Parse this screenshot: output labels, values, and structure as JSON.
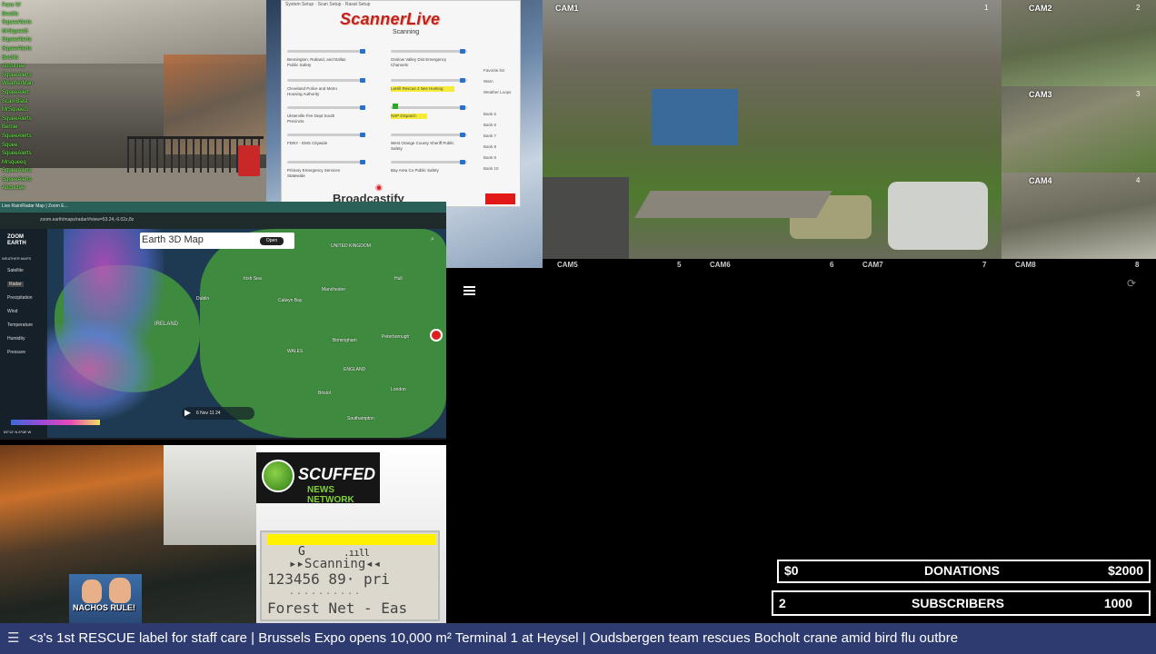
{
  "chat": {
    "lines": [
      "Fans W",
      "BecMc",
      "SqueeAlerts",
      "MrSqueeG",
      "SqueeAlerts",
      "SqueeAlerts",
      "BecMc",
      "Abductee",
      "SqueeAlerts",
      "WeatherMan",
      "SqueeAlert",
      "ScamBlast",
      "MrSqueeG",
      "SqueeAlerts",
      "Bernie",
      "SqueeAlerts",
      "Squee",
      "SqueeAlerts",
      "Mrsqueeq",
      "SqueeAlerts",
      "SqueeAlerts",
      "Abductee"
    ]
  },
  "scanner": {
    "menu": "System Setup · Scan Setup · Rasat Setup",
    "logo": "ScannerLive",
    "status": "Scanning",
    "feeds_left": [
      "Bennington, Rutland, and Dallas Public Safety",
      "Cleveland Police and Metro Housing Authority",
      "Ulsterville Fire Dept South Precincts",
      "FDNY - EMS Citywide",
      "Primary Emergency Services Statewide"
    ],
    "feeds_right": [
      "Onslow Valley Dist Emergency Channels",
      "LaHill Rescue 2 Nes Hunting",
      "NSP Dispatch",
      "West Orange County Sheriff Public Safety",
      "Bay Area Co Public Safety"
    ],
    "radios": [
      "Favorite list",
      "Warn",
      "Weather Loops",
      "",
      "Bank 5",
      "Bank 6",
      "Bank 7",
      "Bank 8",
      "Bank 9",
      "Bank 10"
    ],
    "broadcast_label": "Broadcastify"
  },
  "cams": {
    "cam1": "CAM1",
    "cam1_num": "1",
    "cam2": "CAM2",
    "cam2_num": "2",
    "cam3": "CAM3",
    "cam3_num": "3",
    "cam4": "CAM4",
    "cam4_num": "4",
    "strip": [
      "CAM5",
      "5",
      "CAM6",
      "6",
      "CAM7",
      "7",
      "CAM8",
      "8"
    ]
  },
  "browser": {
    "tab": "Live Rain/Radar Map | Zoom E...",
    "url": "zoom.earth/maps/radar/#view=53.24,-6.02z,8z"
  },
  "map": {
    "brand": "ZOOM EARTH",
    "layers_label": "WEATHER MAPS",
    "layers": [
      "Satellite",
      "Radar",
      "Precipitation",
      "Wind",
      "Temperature",
      "Humidity",
      "Pressure"
    ],
    "earth3d": "Earth 3D Map",
    "open": "Open",
    "places": [
      "UNITED KINGDOM",
      "IRELAND",
      "Dublin",
      "Manchester",
      "Birmingham",
      "ENGLAND",
      "WALES",
      "London",
      "Bristol",
      "Southampton",
      "Calwyn Bay",
      "Irish Sea",
      "Hull",
      "Peterborough"
    ],
    "time": "6 Nov   11   24",
    "coords": "53°12' N  6°08' W"
  },
  "nachos": {
    "text": "NACHOS RULE!"
  },
  "snn": {
    "line1": "SCUFFED",
    "line2": "NEWS NETWORK"
  },
  "lcd": {
    "line1": "G",
    "signal": ".ııll",
    "line2": "▸▸Scanning◂◂",
    "line3": "123456 89·  pri",
    "dots": "..........",
    "line4": "Forest Net - Eas"
  },
  "goals": {
    "donations": {
      "current": "$0",
      "label": "DONATIONS",
      "target": "$2000"
    },
    "subscribers": {
      "current": "2",
      "label": "SUBSCRIBERS",
      "target": "1000"
    }
  },
  "ticker": {
    "icon": "☰",
    "text": "<ɜ's 1st RESCUE label for staff care   |   Brussels Expo opens 10,000 m² Terminal 1 at Heysel   |   Oudsbergen team rescues Bocholt crane amid bird flu outbre"
  }
}
